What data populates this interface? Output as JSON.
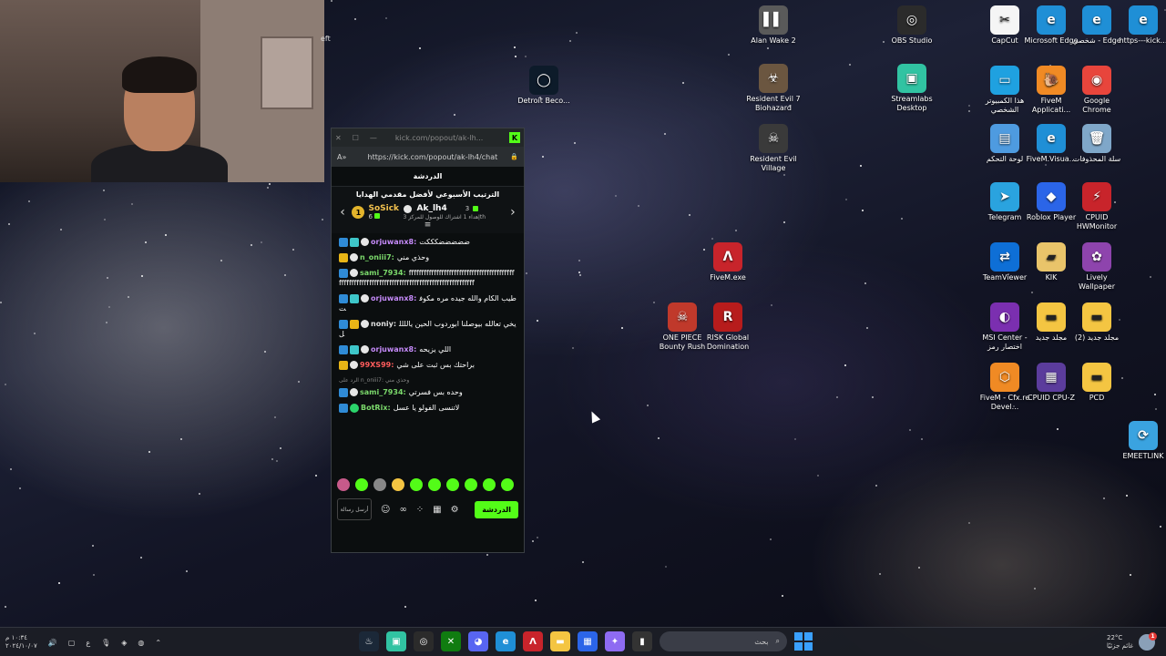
{
  "webcam": {
    "background_text": "eft"
  },
  "desktop_icons": [
    {
      "id": "alan-wake-2",
      "label": "Alan Wake 2",
      "icon": "alan-wake-icon",
      "color": "#5a5a5a",
      "glyph": "▌▌"
    },
    {
      "id": "obs-studio",
      "label": "OBS Studio",
      "icon": "obs-icon",
      "color": "#2b2b2b",
      "glyph": "◎"
    },
    {
      "id": "capcut",
      "label": "CapCut",
      "icon": "capcut-icon",
      "color": "#f5f5f5",
      "glyph": "✂"
    },
    {
      "id": "microsoft-edge",
      "label": "Microsoft Edge",
      "icon": "edge-icon",
      "color": "#1f8fd6",
      "glyph": "e"
    },
    {
      "id": "edge-personal",
      "label": "شخصي - Edge",
      "icon": "edge-icon",
      "color": "#1f8fd6",
      "glyph": "e"
    },
    {
      "id": "https-kick",
      "label": "https---kick...",
      "icon": "edge-icon",
      "color": "#1f8fd6",
      "glyph": "e"
    },
    {
      "id": "detroit",
      "label": "Detroit Beco...",
      "icon": "detroit-icon",
      "color": "#0d1b2a",
      "glyph": "◯"
    },
    {
      "id": "resident-evil-7",
      "label": "Resident Evil 7 Biohazard",
      "icon": "re7-icon",
      "color": "#6b5640",
      "glyph": "☣"
    },
    {
      "id": "streamlabs",
      "label": "Streamlabs Desktop",
      "icon": "streamlabs-icon",
      "color": "#31c3a2",
      "glyph": "▣"
    },
    {
      "id": "this-pc",
      "label": "هذا الكمبيوتر الشخصي",
      "icon": "computer-icon",
      "color": "#1fa1e0",
      "glyph": "▭"
    },
    {
      "id": "fivem-app",
      "label": "FiveM Applicati...",
      "icon": "fivem-icon",
      "color": "#f08a24",
      "glyph": "🐌"
    },
    {
      "id": "google-chrome",
      "label": "Google Chrome",
      "icon": "chrome-icon",
      "color": "#e8453c",
      "glyph": "◉"
    },
    {
      "id": "resident-evil-village",
      "label": "Resident Evil Village",
      "icon": "re-village-icon",
      "color": "#3a3a3a",
      "glyph": "☠"
    },
    {
      "id": "control-panel",
      "label": "لوحة التحكم",
      "icon": "control-panel-icon",
      "color": "#4e9be0",
      "glyph": "▤"
    },
    {
      "id": "fivem-visual",
      "label": "FiveM.Visua...",
      "icon": "edge-icon",
      "color": "#1f8fd6",
      "glyph": "e"
    },
    {
      "id": "recycle-bin",
      "label": "سلة المحذوفات",
      "icon": "recycle-bin-icon",
      "color": "#7fa7c9",
      "glyph": "🗑"
    },
    {
      "id": "telegram",
      "label": "Telegram",
      "icon": "telegram-icon",
      "color": "#2aa3df",
      "glyph": "➤"
    },
    {
      "id": "roblox-player",
      "label": "Roblox Player",
      "icon": "roblox-icon",
      "color": "#2b65e8",
      "glyph": "◆"
    },
    {
      "id": "cpuid-hwmonitor",
      "label": "CPUID HWMonitor",
      "icon": "hwmonitor-icon",
      "color": "#c8242b",
      "glyph": "⚡"
    },
    {
      "id": "fivem-exe",
      "label": "FiveM.exe",
      "icon": "fivem-exe-icon",
      "color": "#c8242b",
      "glyph": "Λ"
    },
    {
      "id": "teamviewer",
      "label": "TeamViewer",
      "icon": "teamviewer-icon",
      "color": "#0e6fd6",
      "glyph": "⇄"
    },
    {
      "id": "kik",
      "label": "KIK",
      "icon": "kik-folder-icon",
      "color": "#e9c46a",
      "glyph": "▰"
    },
    {
      "id": "lively-wallpaper",
      "label": "Lively Wallpaper",
      "icon": "lively-icon",
      "color": "#8e44ad",
      "glyph": "✿"
    },
    {
      "id": "one-piece",
      "label": "ONE PIECE Bounty Rush",
      "icon": "one-piece-icon",
      "color": "#c0392b",
      "glyph": "☠"
    },
    {
      "id": "risk-global",
      "label": "RISK Global Domination",
      "icon": "risk-icon",
      "color": "#b71c1c",
      "glyph": "R"
    },
    {
      "id": "msi-center",
      "label": "MSI Center - اختصار رمز",
      "icon": "msi-icon",
      "color": "#7b2fb0",
      "glyph": "◐"
    },
    {
      "id": "new-folder",
      "label": "مجلد جديد",
      "icon": "folder-icon",
      "color": "#f4c542",
      "glyph": "▬"
    },
    {
      "id": "new-folder-2",
      "label": "مجلد جديد (2)",
      "icon": "folder-icon",
      "color": "#f4c542",
      "glyph": "▬"
    },
    {
      "id": "fivem-cfx",
      "label": "FiveM - Cfx.re Devel...",
      "icon": "fivem-cfx-icon",
      "color": "#f08a24",
      "glyph": "⬡"
    },
    {
      "id": "cpuid-cpuz",
      "label": "CPUID CPU-Z",
      "icon": "cpuz-icon",
      "color": "#5b3c9c",
      "glyph": "▦"
    },
    {
      "id": "pcd",
      "label": "PCD",
      "icon": "folder-icon",
      "color": "#f4c542",
      "glyph": "▬"
    },
    {
      "id": "emeetlink",
      "label": "EMEETLINK",
      "icon": "emeetlink-icon",
      "color": "#3aa3e0",
      "glyph": "⟳"
    }
  ],
  "kick": {
    "title_bar": {
      "close": "✕",
      "maximize": "☐",
      "minimize": "—",
      "page_title": "kick.com/popout/ak-lh..."
    },
    "address_bar": {
      "read_aloud": "A»",
      "url": "https://kick.com/popout/ak-lh4/chat",
      "lock": "🔒"
    },
    "header": "الدردشة",
    "leaderboard": {
      "title": "الترتيب الأسبوعي لأفضل مقدمي الهدايا",
      "left_user": {
        "rank": "1",
        "name": "SoSick",
        "count": "6"
      },
      "right_user": {
        "name": "Ak_lh4",
        "count": "3",
        "note": "إهداء 1 اشتراك للوصول للمركز 3th"
      },
      "prev_arrow": "‹",
      "next_arrow": "›"
    },
    "messages": [
      {
        "user": "orjuwanx8:",
        "color": "#c58af9",
        "text": "ضضضضضكككت",
        "badges": [
          "blue",
          "teal",
          "skull"
        ]
      },
      {
        "user": "n_oniii7:",
        "color": "#7bd96b",
        "text": "وحذي مني",
        "badges": [
          "gold",
          "skull"
        ]
      },
      {
        "user": "sami_7934:",
        "color": "#7bd96b",
        "text": "ffffffffffffffffffffffffffffffffffffffffffffffffffffffffffffffffffffffffffffffffffffffffffffffff",
        "badges": [
          "blue",
          "skull"
        ]
      },
      {
        "user": "orjuwanx8:",
        "color": "#c58af9",
        "text": "طيب الكام والله جيده مره مكوفت",
        "badges": [
          "blue",
          "teal",
          "skull"
        ]
      },
      {
        "user": "noniy:",
        "color": "#e0e0e0",
        "text": "يخي تعالله بيوصلنا ابوردوب الحين ياللللل",
        "badges": [
          "blue",
          "gold",
          "skull"
        ]
      },
      {
        "user": "orjuwanx8:",
        "color": "#c58af9",
        "text": "اللي يزيحه",
        "badges": [
          "blue",
          "teal",
          "skull"
        ]
      },
      {
        "user": "99XS99:",
        "color": "#ff5c5c",
        "text": "براحتك بس ثبت على شي",
        "badges": [
          "gold",
          "skull"
        ]
      },
      {
        "user": "sami_7934:",
        "color": "#7bd96b",
        "text": "وحده بس فسرتي",
        "badges": [
          "blue",
          "skull"
        ],
        "reply": "الرد على n_oniii7: وحذي مني"
      },
      {
        "user": "BotRix:",
        "color": "#7bd96b",
        "text": "لاتنسى الفولو يا عسل",
        "badges": [
          "blue",
          "green"
        ]
      }
    ],
    "emote_colors": [
      "#c75a8a",
      "#53fc18",
      "#888",
      "#f4c542",
      "#53fc18",
      "#53fc18",
      "#53fc18",
      "#53fc18",
      "#53fc18",
      "#53fc18"
    ],
    "footer": {
      "input_placeholder": "أرسل رسالة",
      "emoji": "☺",
      "infinity": "∞",
      "dots": "⁘",
      "store": "▦",
      "settings": "⚙",
      "send_label": "الدردشة"
    }
  },
  "taskbar": {
    "time": "١٠:٣٤ م",
    "date": "٢٠٢٤/١٠/٠٧",
    "lang": "ع",
    "search_placeholder": "بحث",
    "weather_temp": "22°C",
    "weather_desc": "غائم جزئيًا",
    "notification_count": "1",
    "apps": [
      {
        "name": "steam-app",
        "color": "#1b2838",
        "glyph": "♨"
      },
      {
        "name": "streamlabs-app",
        "color": "#31c3a2",
        "glyph": "▣"
      },
      {
        "name": "obs-app",
        "color": "#2b2b2b",
        "glyph": "◎"
      },
      {
        "name": "xbox-app",
        "color": "#107c10",
        "glyph": "✕"
      },
      {
        "name": "discord-app",
        "color": "#5865f2",
        "glyph": "◕"
      },
      {
        "name": "edge-app",
        "color": "#1f8fd6",
        "glyph": "e"
      },
      {
        "name": "fivem-app",
        "color": "#c8242b",
        "glyph": "Λ"
      },
      {
        "name": "file-explorer-app",
        "color": "#f4c542",
        "glyph": "▬"
      },
      {
        "name": "microsoft-store-app",
        "color": "#2b65e8",
        "glyph": "▦"
      },
      {
        "name": "copilot-app",
        "color": "#8e6bf2",
        "glyph": "✦"
      },
      {
        "name": "terminal-app",
        "color": "#333",
        "glyph": "▮"
      }
    ]
  }
}
